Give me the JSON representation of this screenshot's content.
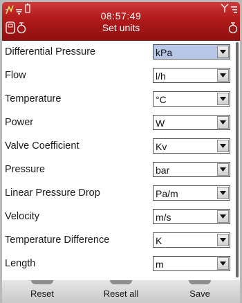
{
  "status_bar": {
    "time": "08:57:49",
    "title": "Set units",
    "icons": [
      "signal-icon",
      "battery-icon",
      "device-icon",
      "pressure-sensor-icon",
      "antenna-icon",
      "menu-lines-icon",
      "sensor-icon"
    ]
  },
  "units": [
    {
      "label": "Differential Pressure",
      "value": "kPa",
      "highlighted": true
    },
    {
      "label": "Flow",
      "value": "l/h"
    },
    {
      "label": "Temperature",
      "value": "°C"
    },
    {
      "label": "Power",
      "value": "W"
    },
    {
      "label": "Valve Coefficient",
      "value": "Kv"
    },
    {
      "label": "Pressure",
      "value": "bar"
    },
    {
      "label": "Linear Pressure Drop",
      "value": "Pa/m"
    },
    {
      "label": "Velocity",
      "value": "m/s"
    },
    {
      "label": "Temperature Difference",
      "value": "K"
    },
    {
      "label": "Length",
      "value": "m"
    }
  ],
  "softkeys": {
    "left": "Reset",
    "middle": "Reset all",
    "right": "Save"
  },
  "colors": {
    "header": "#b31b1b",
    "selected_field": "#b8c7e8"
  }
}
